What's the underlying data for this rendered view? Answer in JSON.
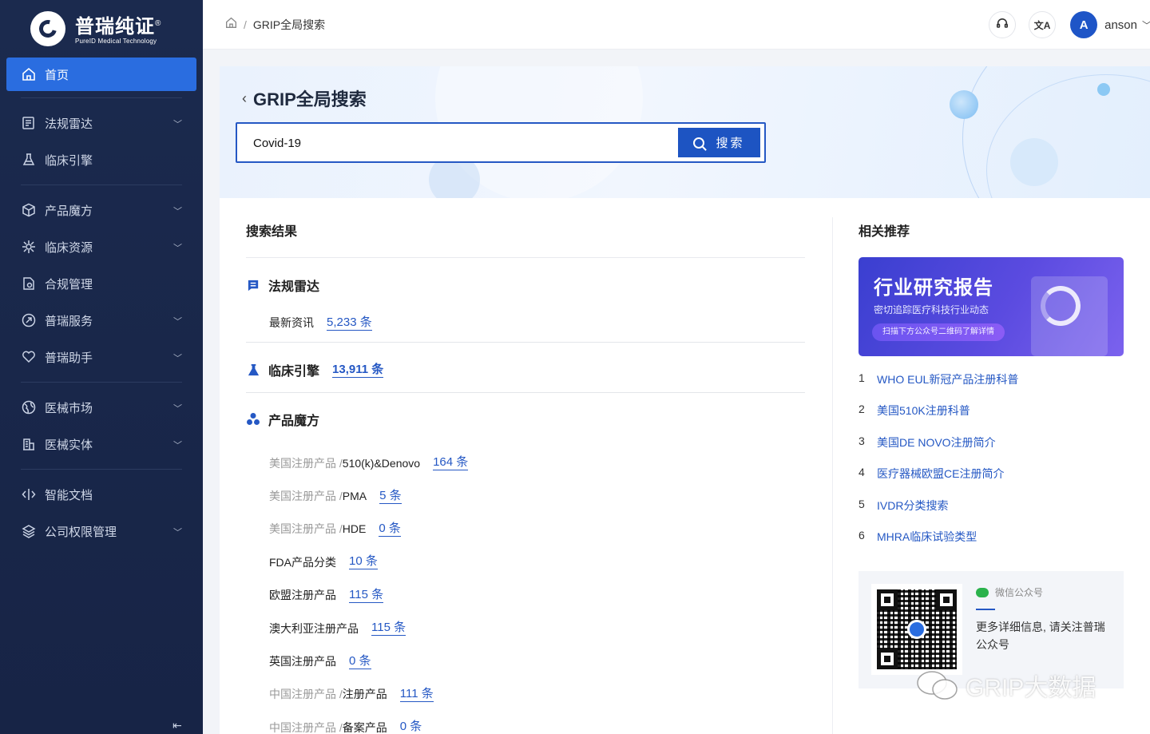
{
  "logo": {
    "cn": "普瑞纯证",
    "registered": "®",
    "en": "PureID Medical Technology"
  },
  "sidebar": {
    "items": [
      {
        "label": "首页",
        "icon": "home-icon",
        "active": true,
        "expandable": false
      },
      {
        "label": "法规雷达",
        "icon": "regulation-radar-icon",
        "active": false,
        "expandable": true
      },
      {
        "label": "临床引擎",
        "icon": "flask-icon",
        "active": false,
        "expandable": false
      },
      {
        "label": "产品魔方",
        "icon": "cube-icon",
        "active": false,
        "expandable": true
      },
      {
        "label": "临床资源",
        "icon": "gear-network-icon",
        "active": false,
        "expandable": true
      },
      {
        "label": "合规管理",
        "icon": "document-check-icon",
        "active": false,
        "expandable": false
      },
      {
        "label": "普瑞服务",
        "icon": "service-icon",
        "active": false,
        "expandable": true
      },
      {
        "label": "普瑞助手",
        "icon": "heart-hand-icon",
        "active": false,
        "expandable": true
      },
      {
        "label": "医械市场",
        "icon": "globe-icon",
        "active": false,
        "expandable": true
      },
      {
        "label": "医械实体",
        "icon": "building-icon",
        "active": false,
        "expandable": true
      },
      {
        "label": "智能文档",
        "icon": "code-doc-icon",
        "active": false,
        "expandable": false
      },
      {
        "label": "公司权限管理",
        "icon": "layers-icon",
        "active": false,
        "expandable": true
      }
    ]
  },
  "header": {
    "breadcrumb": {
      "home_icon": "home-icon",
      "separator": "/",
      "current": "GRIP全局搜索"
    },
    "user": {
      "avatar_letter": "A",
      "name": "anson"
    }
  },
  "banner": {
    "title": "GRIP全局搜索",
    "search": {
      "value": "Covid-19",
      "button_label": "搜索"
    }
  },
  "results": {
    "title": "搜索结果",
    "regulation": {
      "title": "法规雷达",
      "rows": [
        {
          "label": "最新资讯",
          "count": "5,233 条"
        }
      ]
    },
    "clinical": {
      "title": "临床引擎",
      "count": "13,911 条"
    },
    "product": {
      "title": "产品魔方",
      "rows": [
        {
          "prefix": "美国注册产品 / ",
          "label": "510(k)&Denovo",
          "count": "164 条"
        },
        {
          "prefix": "美国注册产品 / ",
          "label": "PMA",
          "count": "5 条"
        },
        {
          "prefix": "美国注册产品 / ",
          "label": "HDE",
          "count": "0 条"
        },
        {
          "prefix": "",
          "label": "FDA产品分类",
          "count": "10 条"
        },
        {
          "prefix": "",
          "label": "欧盟注册产品",
          "count": "115 条"
        },
        {
          "prefix": "",
          "label": "澳大利亚注册产品",
          "count": "115 条"
        },
        {
          "prefix": "",
          "label": "英国注册产品",
          "count": "0 条"
        },
        {
          "prefix": "中国注册产品 / ",
          "label": "注册产品",
          "count": "111 条"
        },
        {
          "prefix": "中国注册产品 / ",
          "label": "备案产品",
          "count": "0 条"
        }
      ]
    }
  },
  "recommend": {
    "title": "相关推荐",
    "promo": {
      "heading": "行业研究报告",
      "sub": "密切追踪医疗科技行业动态",
      "pill": "扫描下方公众号二维码了解详情"
    },
    "items": [
      {
        "num": "1",
        "label": "WHO EUL新冠产品注册科普"
      },
      {
        "num": "2",
        "label": "美国510K注册科普"
      },
      {
        "num": "3",
        "label": "美国DE NOVO注册简介"
      },
      {
        "num": "4",
        "label": "医疗器械欧盟CE注册简介"
      },
      {
        "num": "5",
        "label": "IVDR分类搜索"
      },
      {
        "num": "6",
        "label": "MHRA临床试验类型"
      }
    ],
    "wechat": {
      "label": "微信公众号",
      "text": "更多详细信息, 请关注普瑞公众号"
    }
  },
  "watermark": "GRIP大数据",
  "colors": {
    "sidebar_bg": "#1b2a4e",
    "accent": "#2558c4",
    "active_nav": "#2a6de0"
  }
}
